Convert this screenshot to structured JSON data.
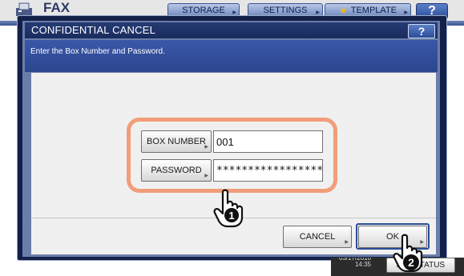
{
  "header": {
    "app_title": "FAX",
    "fax_icon": "fax-icon",
    "buttons": {
      "storage": "STORAGE",
      "settings": "SETTINGS",
      "template": "TEMPLATE"
    },
    "template_icon": "star-icon",
    "help": "?"
  },
  "dialog": {
    "title": "CONFIDENTIAL CANCEL",
    "help": "?",
    "message": "Enter the Box Number and Password.",
    "box_number": {
      "label": "BOX NUMBER",
      "value": "001"
    },
    "password": {
      "label": "PASSWORD",
      "value": "*****************"
    },
    "cancel_label": "CANCEL",
    "ok_label": "OK"
  },
  "callouts": {
    "step1": "1",
    "step2": "2"
  },
  "status_bar": {
    "date_partial": "03/17/2010",
    "time": "14:35",
    "job_status_label": "JOB STATUS"
  },
  "colors": {
    "highlight_ring": "#f29d7a",
    "dialog_title_bg": "#1a2c5e",
    "message_bar_bg": "#2c468f"
  }
}
